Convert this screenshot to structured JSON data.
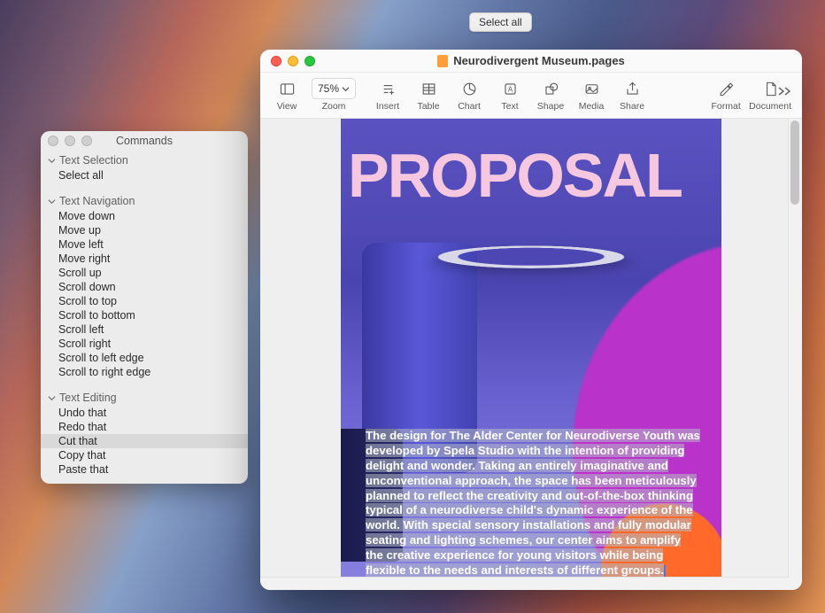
{
  "tooltip": {
    "text": "Select all"
  },
  "commands_window": {
    "title": "Commands",
    "sections": [
      {
        "header": "Text Selection",
        "items": [
          "Select all"
        ]
      },
      {
        "header": "Text Navigation",
        "items": [
          "Move down",
          "Move up",
          "Move left",
          "Move right",
          "Scroll up",
          "Scroll down",
          "Scroll to top",
          "Scroll to bottom",
          "Scroll left",
          "Scroll right",
          "Scroll to left edge",
          "Scroll to right edge"
        ]
      },
      {
        "header": "Text Editing",
        "items": [
          "Undo that",
          "Redo that",
          "Cut that",
          "Copy that",
          "Paste that"
        ]
      }
    ],
    "selected": "Cut that"
  },
  "pages_window": {
    "document_title": "Neurodivergent Museum.pages",
    "toolbar": {
      "view": "View",
      "zoom_label": "Zoom",
      "zoom_value": "75%",
      "insert": "Insert",
      "table": "Table",
      "chart": "Chart",
      "text": "Text",
      "shape": "Shape",
      "media": "Media",
      "share": "Share",
      "format": "Format",
      "document": "Document"
    },
    "page": {
      "heading": "PROPOSAL",
      "body": "The design for The Alder Center for Neurodiverse Youth was developed by Spela Studio with the intention of providing delight and wonder. Taking an entirely imaginative and unconventional approach, the space has been meticulously planned to reflect the creativity and out-of-the-box thinking typical of a neurodiverse child's dynamic experience of the world. With special sensory installations and fully modular seating and lighting schemes, our center aims to amplify the creative experience for young visitors while being flexible to the needs and interests of different groups."
    }
  }
}
